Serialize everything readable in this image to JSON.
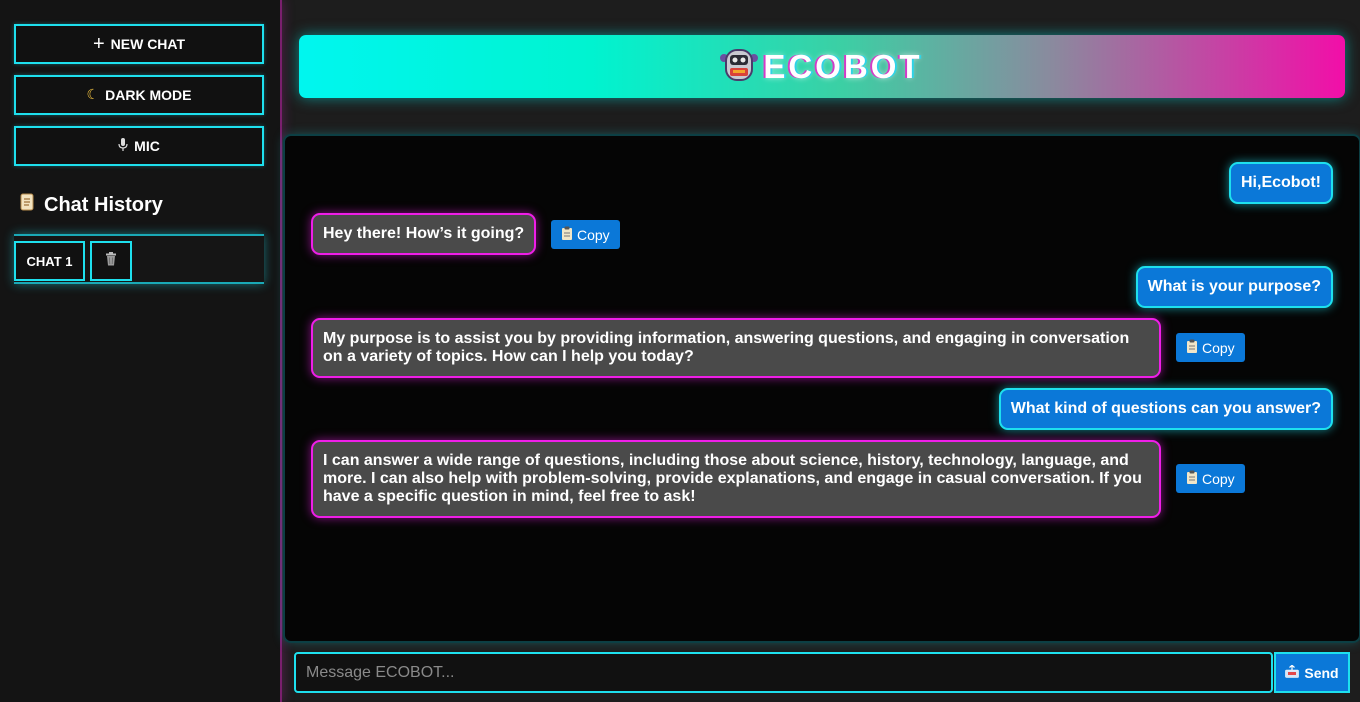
{
  "sidebar": {
    "new_chat_label": "NEW CHAT",
    "dark_mode_label": "DARK MODE",
    "mic_label": "MIC",
    "history_title": "Chat History",
    "chats": [
      {
        "label": "CHAT 1"
      }
    ]
  },
  "header": {
    "brand": "ECOBOT",
    "logo_icon": "robot-icon"
  },
  "messages": [
    {
      "role": "user",
      "text": "Hi,Ecobot!"
    },
    {
      "role": "bot",
      "text": "Hey there! How’s it going?"
    },
    {
      "role": "user",
      "text": "What is your purpose?"
    },
    {
      "role": "bot",
      "text": "My purpose is to assist you by providing information, answering questions, and engaging in conversation on a variety of topics. How can I help you today?"
    },
    {
      "role": "user",
      "text": "What kind of questions can you answer?"
    },
    {
      "role": "bot",
      "text": "I can answer a wide range of questions, including those about science, history, technology, language, and more. I can also help with problem-solving, provide explanations, and engage in casual conversation. If you have a specific question in mind, feel free to ask!"
    }
  ],
  "copy_label": "Copy",
  "composer": {
    "placeholder": "Message ECOBOT...",
    "send_label": "Send"
  },
  "colors": {
    "accent_cyan": "#1ee0ee",
    "accent_magenta": "#ef1ee8",
    "user_bubble": "#0b78d8",
    "bot_bubble": "#4a4a4a"
  }
}
